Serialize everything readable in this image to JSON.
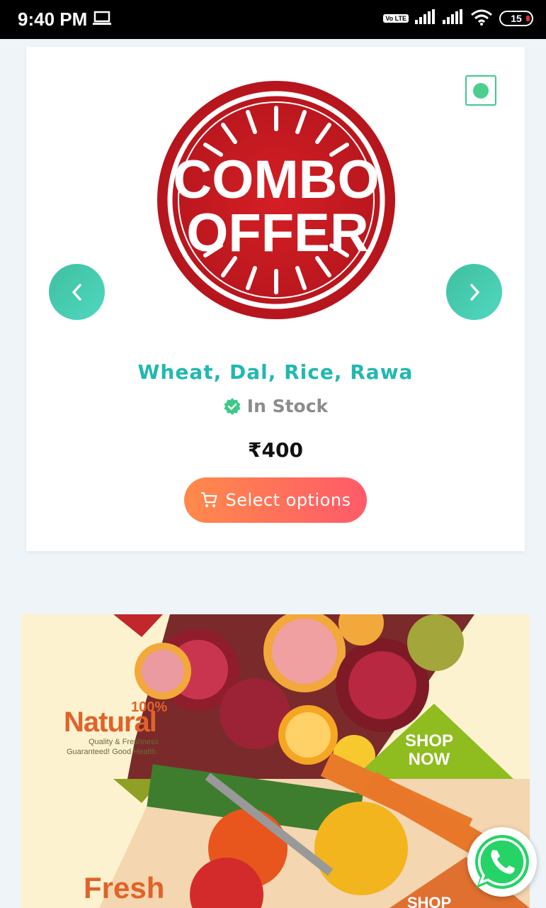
{
  "status_bar": {
    "time": "9:40 PM",
    "volte": "Vo LTE",
    "battery": "15"
  },
  "product": {
    "image_text_line1": "COMBO",
    "image_text_line2": "OFFER",
    "title": "Wheat, Dal, Rice, Rawa",
    "stock": "In Stock",
    "price": "₹400",
    "button_label": "Select options"
  },
  "banner": {
    "natural_percent": "100%",
    "natural": "Natural",
    "quality": "Quality & Freshness",
    "guarantee": "Guaranteed! Good Health.",
    "shop_now_line1": "SHOP",
    "shop_now_line2": "NOW",
    "fresh": "Fresh",
    "shop2": "SHOP"
  },
  "colors": {
    "teal_title": "#21b8b0",
    "arrow": "#46cdb3",
    "button_start": "#ff8a4a",
    "button_end": "#ff5a6a",
    "badge_green": "#3cc98a",
    "whatsapp": "#25d366"
  }
}
